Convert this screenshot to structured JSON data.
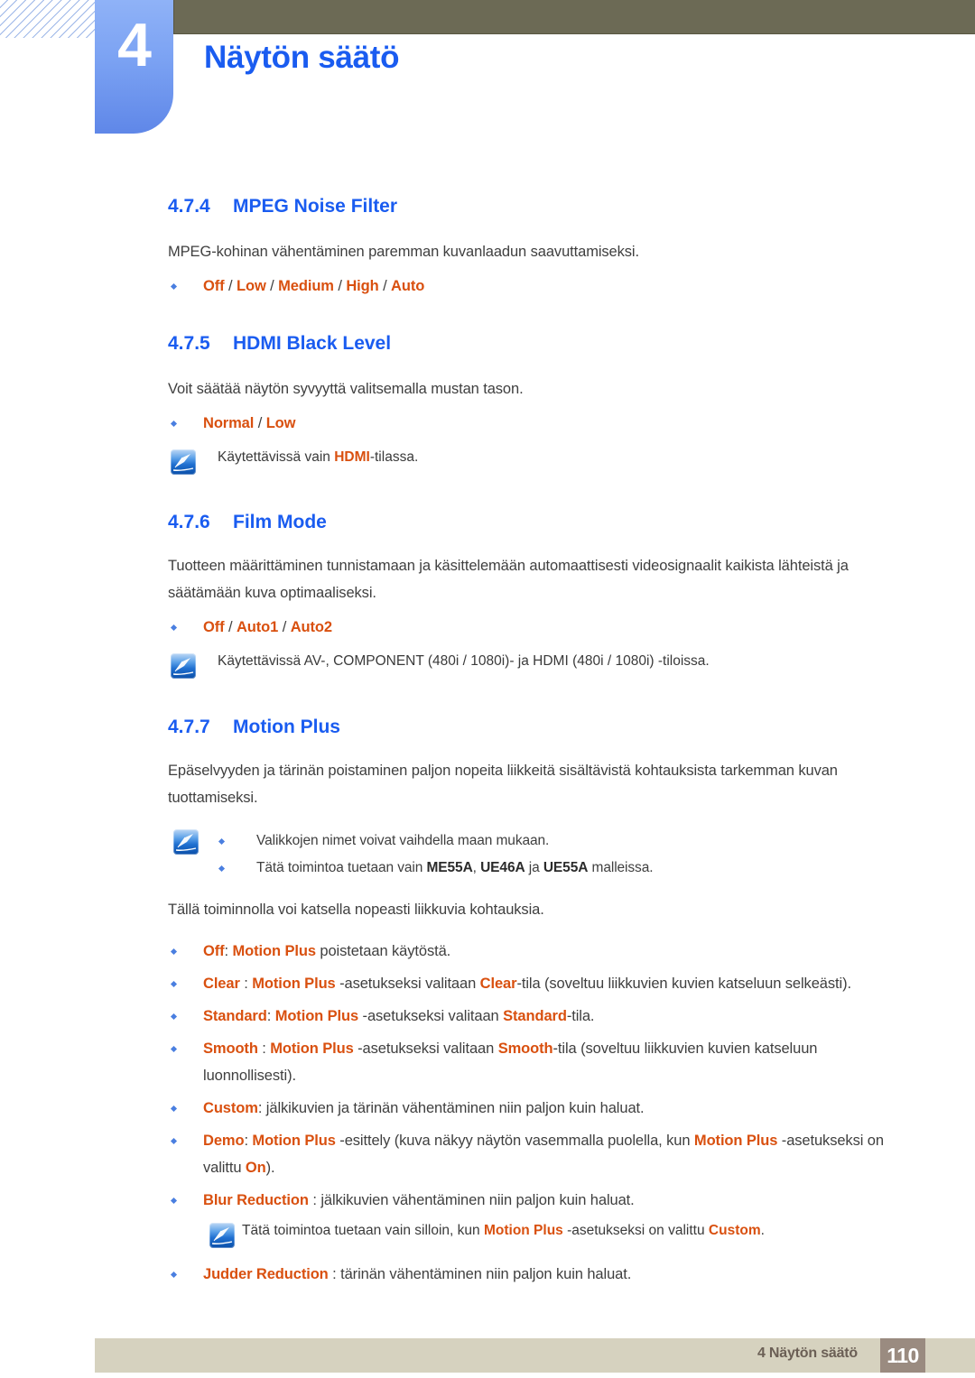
{
  "header": {
    "chapter_number": "4",
    "chapter_title": "Näytön säätö",
    "accent_blue": "#1a5cf0",
    "olive": "#6c6a55",
    "tab_blue": "#7ba2f3"
  },
  "icons": {
    "note": "note-pen-icon",
    "bullet": "diamond-bullet-icon"
  },
  "sections": [
    {
      "number": "4.7.4",
      "title": "MPEG Noise Filter",
      "paragraph": "MPEG-kohinan vähentäminen paremman kuvanlaadun saavuttamiseksi.",
      "options": [
        "Off",
        "Low",
        "Medium",
        "High",
        "Auto"
      ],
      "options_sep": " / "
    },
    {
      "number": "4.7.5",
      "title": "HDMI Black Level",
      "paragraph": "Voit säätää näytön syvyyttä valitsemalla mustan tason.",
      "options": [
        "Normal",
        "Low"
      ],
      "options_sep": " / ",
      "note_prefix": "Käytettävissä vain ",
      "note_highlight": "HDMI",
      "note_suffix": "-tilassa."
    },
    {
      "number": "4.7.6",
      "title": "Film Mode",
      "paragraph": "Tuotteen määrittäminen tunnistamaan ja käsittelemään automaattisesti videosignaalit kaikista lähteistä ja säätämään kuva optimaaliseksi.",
      "options": [
        "Off",
        "Auto1",
        "Auto2"
      ],
      "options_sep": " / ",
      "note": "Käytettävissä AV-, COMPONENT (480i / 1080i)- ja HDMI (480i / 1080i) -tiloissa."
    },
    {
      "number": "4.7.7",
      "title": "Motion Plus",
      "paragraph": "Epäselvyyden ja tärinän poistaminen paljon nopeita liikkeitä sisältävistä kohtauksista tarkemman kuvan tuottamiseksi."
    }
  ],
  "motion_plus": {
    "note_bullets": [
      "Valikkojen nimet voivat vaihdella maan mukaan.",
      {
        "pre": "Tätä toimintoa tuetaan vain ",
        "models": [
          "ME55A",
          "UE46A",
          "UE55A"
        ],
        "conj": " ja ",
        "sep": ", ",
        "post": " malleissa."
      }
    ],
    "intro": "Tällä toiminnolla voi katsella nopeasti liikkuvia kohtauksia.",
    "items": [
      {
        "term": "Off",
        "after_term": ": ",
        "feature": "Motion Plus",
        "rest": " poistetaan käytöstä."
      },
      {
        "term": "Clear",
        "after_term": " : ",
        "feature": "Motion Plus",
        "mid": " -asetukseksi valitaan ",
        "value": "Clear",
        "rest": "-tila (soveltuu liikkuvien kuvien katseluun selkeästi)."
      },
      {
        "term": "Standard",
        "after_term": ": ",
        "feature": "Motion Plus",
        "mid": " -asetukseksi valitaan ",
        "value": "Standard",
        "rest": "-tila."
      },
      {
        "term": "Smooth",
        "after_term": " : ",
        "feature": "Motion Plus",
        "mid": " -asetukseksi valitaan ",
        "value": "Smooth",
        "rest": "-tila (soveltuu liikkuvien kuvien katseluun luonnollisesti)."
      },
      {
        "term": "Custom",
        "after_term": ": ",
        "rest": "jälkikuvien ja tärinän vähentäminen niin paljon kuin haluat."
      },
      {
        "term": "Demo",
        "after_term": ": ",
        "feature": "Motion Plus",
        "mid": " -esittely (kuva näkyy näytön vasemmalla puolella, kun ",
        "feature2": "Motion Plus",
        "mid2": " -asetukseksi on valittu ",
        "value": "On",
        "rest": ")."
      },
      {
        "term": "Blur Reduction",
        "after_term": " : ",
        "rest": "jälkikuvien vähentäminen niin paljon kuin haluat."
      },
      {
        "term": "Judder Reduction",
        "after_term": " : ",
        "rest": "tärinän vähentäminen niin paljon kuin haluat."
      }
    ],
    "inner_note": {
      "pre": "Tätä toimintoa tuetaan vain silloin, kun ",
      "feature": "Motion Plus",
      "mid": " -asetukseksi on valittu ",
      "value": "Custom",
      "post": "."
    }
  },
  "footer": {
    "label": "4 Näytön säätö",
    "page": "110"
  }
}
